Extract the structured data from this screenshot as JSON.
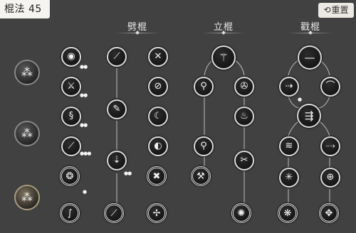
{
  "header": {
    "title": "棍法 45",
    "reset_label": "重置",
    "reset_icon": "reset-icon"
  },
  "columns": [
    {
      "id": "pi",
      "label": "劈棍"
    },
    {
      "id": "li",
      "label": "立棍"
    },
    {
      "id": "chuo",
      "label": "戳棍"
    }
  ],
  "colors": {
    "background": "#414141",
    "node_border": "#d9d9d9",
    "text": "#e6e6e6"
  }
}
